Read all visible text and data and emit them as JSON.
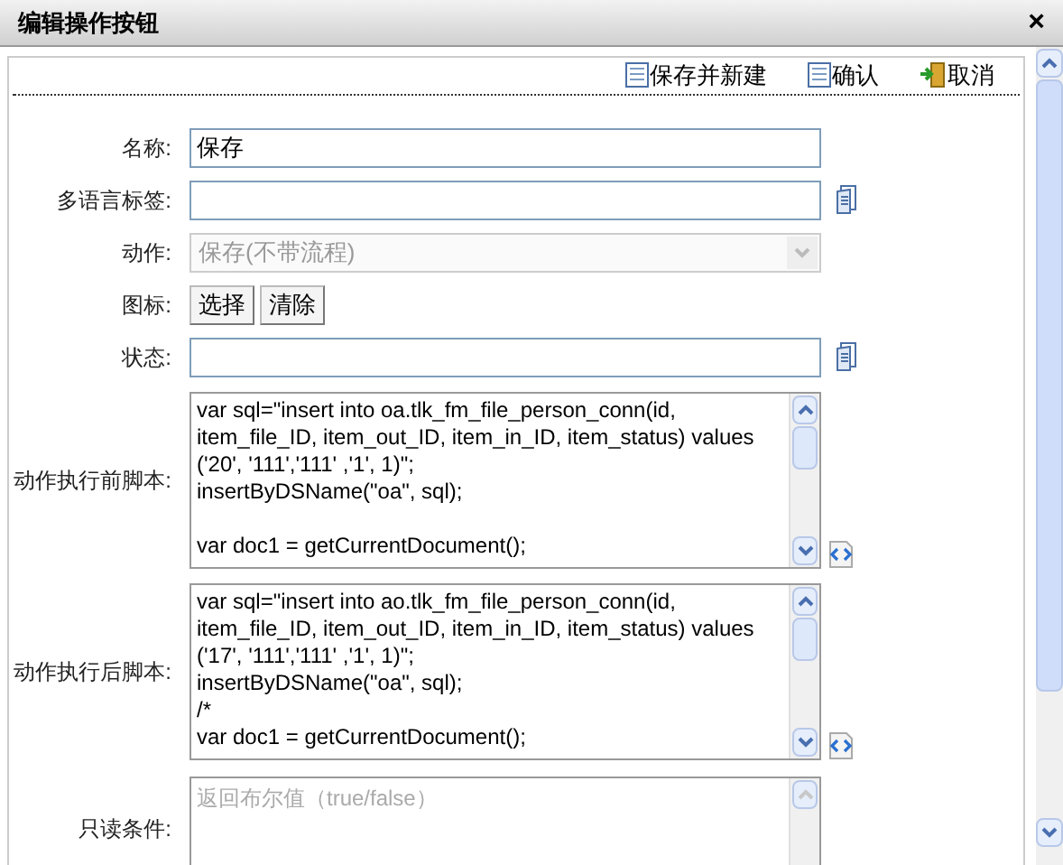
{
  "window": {
    "title": "编辑操作按钮",
    "close": "×"
  },
  "toolbar": [
    {
      "label": "保存并新建",
      "kind": "save"
    },
    {
      "label": "确认",
      "kind": "save"
    },
    {
      "label": "取消",
      "kind": "exit"
    }
  ],
  "fields": [
    {
      "kind": "text",
      "label": "名称:",
      "value": "保存"
    },
    {
      "kind": "text",
      "label": "多语言标签:",
      "icon": true
    },
    {
      "kind": "select",
      "label": "动作:",
      "value": "保存(不带流程)",
      "disabled": true
    },
    {
      "kind": "buttons",
      "label": "图标:",
      "buttons": [
        "选择",
        "清除"
      ]
    },
    {
      "kind": "text",
      "label": "状态:",
      "icon": true
    },
    {
      "kind": "script",
      "label": "动作执行前脚本:",
      "blocks": [
        [
          "var sql=\"insert into oa.tlk_fm_file_person_conn(id,",
          "item_file_ID, item_out_ID, item_in_ID, item_status) values",
          "('20', '111','111' ,'1', 1)\";",
          "insertByDSName(\"oa\", sql);"
        ],
        [
          "var doc1 = getCurrentDocument();"
        ]
      ]
    },
    {
      "kind": "script",
      "label": "动作执行后脚本:",
      "blocks": [
        [
          "var sql=\"insert into ao.tlk_fm_file_person_conn(id,",
          "item_file_ID, item_out_ID, item_in_ID, item_status) values",
          "('17', '111','111' ,'1', 1)\";",
          "insertByDSName(\"oa\", sql);",
          "/*",
          "var doc1 = getCurrentDocument();"
        ]
      ]
    },
    {
      "kind": "condition",
      "label": "只读条件:",
      "placeholder": "返回布尔值（true/false）"
    }
  ]
}
